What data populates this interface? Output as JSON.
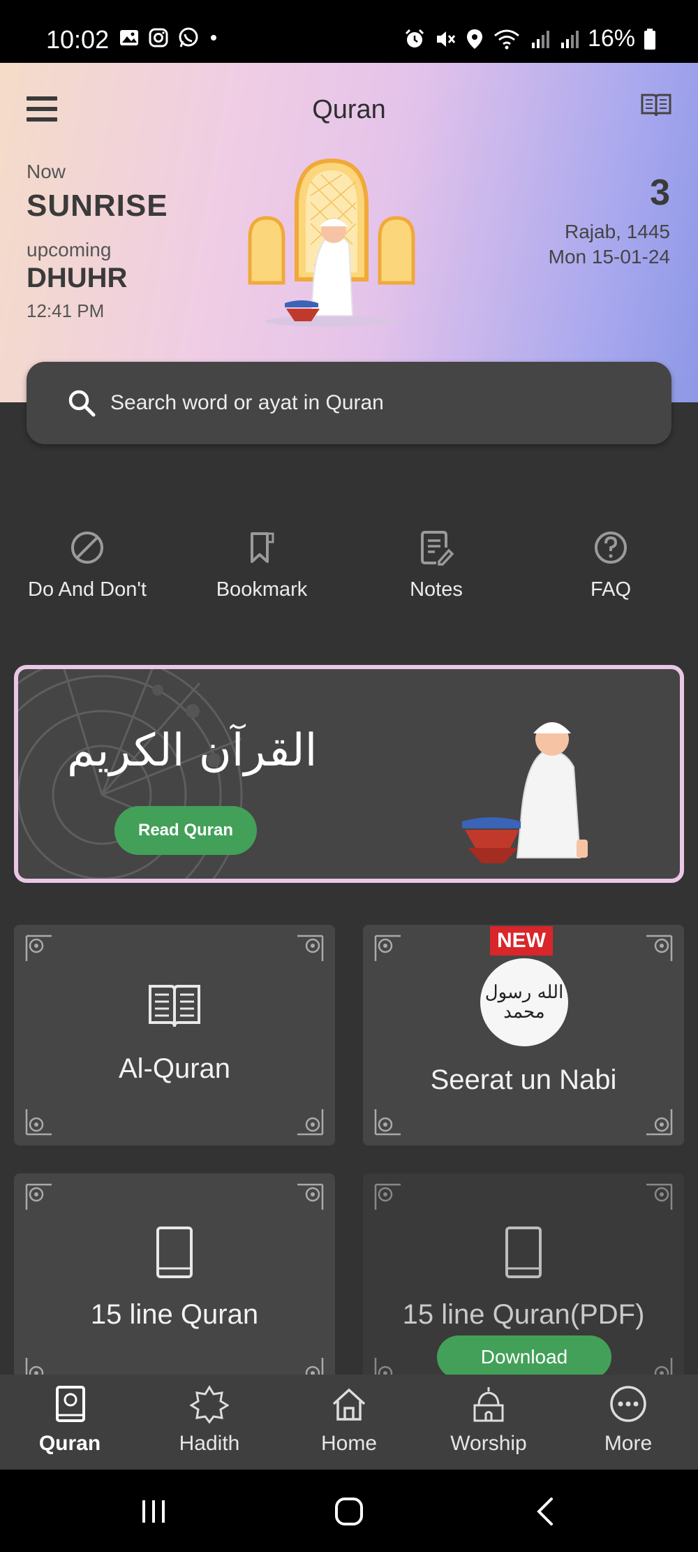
{
  "status_bar": {
    "time": "10:02",
    "left_icons": [
      "gallery-icon",
      "instagram-icon",
      "whatsapp-icon",
      "dot-icon"
    ],
    "right_icons": [
      "alarm-icon",
      "mute-icon",
      "location-icon",
      "wifi-icon",
      "signal-icon",
      "signal-icon"
    ],
    "battery": "16%"
  },
  "header": {
    "title": "Quran",
    "now_label": "Now",
    "now_prayer": "SUNRISE",
    "upcoming_label": "upcoming",
    "upcoming_prayer": "DHUHR",
    "upcoming_time": "12:41 PM",
    "hijri_day": "3",
    "hijri_month_year": "Rajab, 1445",
    "gregorian_date": "Mon 15-01-24"
  },
  "search": {
    "placeholder": "Search word or ayat in Quran"
  },
  "quick_actions": [
    {
      "label": "Do And Don't",
      "icon": "prohibited-icon"
    },
    {
      "label": "Bookmark",
      "icon": "bookmark-icon"
    },
    {
      "label": "Notes",
      "icon": "notes-icon"
    },
    {
      "label": "FAQ",
      "icon": "faq-icon"
    }
  ],
  "banner": {
    "arabic_title": "القرآن الكريم",
    "button_label": "Read Quran",
    "border_color": "#e9c7e5",
    "button_color": "#43a059"
  },
  "cards": [
    {
      "label": "Al-Quran",
      "icon": "open-book-icon"
    },
    {
      "label": "Seerat un Nabi",
      "badge": "NEW",
      "seal_text": "الله رسول محمد"
    },
    {
      "label": "15 line Quran",
      "icon": "book-icon"
    },
    {
      "label": "15 line Quran(PDF)",
      "icon": "book-icon",
      "button_label": "Download"
    }
  ],
  "bottom_nav": [
    {
      "label": "Quran",
      "icon": "quran-icon",
      "active": true
    },
    {
      "label": "Hadith",
      "icon": "star-icon",
      "active": false
    },
    {
      "label": "Home",
      "icon": "home-icon",
      "active": false
    },
    {
      "label": "Worship",
      "icon": "mosque-icon",
      "active": false
    },
    {
      "label": "More",
      "icon": "more-icon",
      "active": false
    }
  ],
  "colors": {
    "background": "#333333",
    "accent_green": "#43a059",
    "badge_red": "#d8262b"
  }
}
